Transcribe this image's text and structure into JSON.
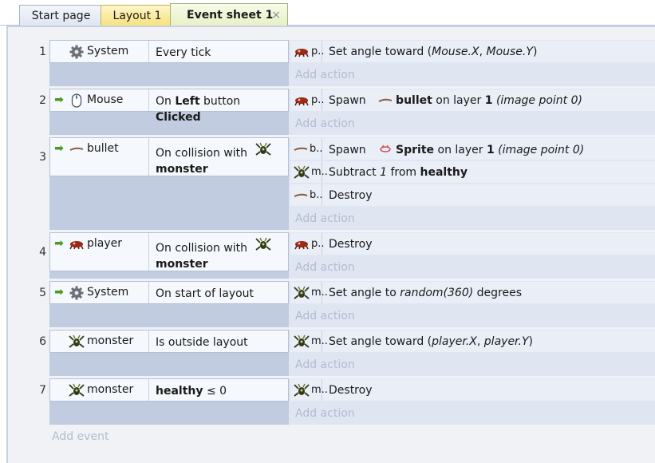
{
  "tabs": [
    {
      "label": "Start page"
    },
    {
      "label": "Layout 1"
    },
    {
      "label": "Event sheet 1",
      "close": "×"
    }
  ],
  "events": [
    {
      "number": "1",
      "trigger": false,
      "object": {
        "icon": "gear-icon",
        "name": "System"
      },
      "condition": {
        "parts": [
          "Every tick"
        ]
      },
      "actions": [
        {
          "icon": "player-sprite-icon",
          "obj": "p..",
          "parts": [
            "Set angle toward (",
            "Mouse.X",
            ", ",
            "Mouse.Y",
            ")"
          ]
        }
      ],
      "add_action": "Add action"
    },
    {
      "number": "2",
      "trigger": true,
      "object": {
        "icon": "mouse-icon",
        "name": "Mouse"
      },
      "condition": {
        "parts": [
          "On ",
          "Left",
          " button ",
          "Clicked"
        ]
      },
      "actions": [
        {
          "icon": "player-sprite-icon",
          "obj": "p..",
          "parts": [
            "Spawn",
            "bullet",
            " on layer ",
            "1",
            " (image point 0)"
          ]
        }
      ],
      "add_action": "Add action"
    },
    {
      "number": "3",
      "trigger": true,
      "object": {
        "icon": "bullet-icon",
        "name": "bullet"
      },
      "condition": {
        "parts": [
          "On collision with",
          "monster"
        ]
      },
      "actions": [
        {
          "icon": "bullet-icon",
          "obj": "b..",
          "parts": [
            "Spawn",
            "Sprite",
            " on layer ",
            "1",
            " (image point 0)"
          ]
        },
        {
          "icon": "monster-icon",
          "obj": "m..",
          "parts": [
            "Subtract ",
            "1",
            " from ",
            "healthy"
          ]
        },
        {
          "icon": "bullet-icon",
          "obj": "b..",
          "parts": [
            "Destroy"
          ]
        }
      ],
      "add_action": "Add action"
    },
    {
      "number": "4",
      "trigger": true,
      "object": {
        "icon": "player-sprite-icon",
        "name": "player"
      },
      "condition": {
        "parts": [
          "On collision with",
          "monster"
        ]
      },
      "actions": [
        {
          "icon": "player-sprite-icon",
          "obj": "p..",
          "parts": [
            "Destroy"
          ]
        }
      ],
      "add_action": "Add action"
    },
    {
      "number": "5",
      "trigger": true,
      "object": {
        "icon": "gear-icon",
        "name": "System"
      },
      "condition": {
        "parts": [
          "On start of layout"
        ]
      },
      "actions": [
        {
          "icon": "monster-icon",
          "obj": "m..",
          "parts": [
            "Set angle to ",
            "random(360)",
            "  degrees"
          ]
        }
      ],
      "add_action": "Add action"
    },
    {
      "number": "6",
      "trigger": false,
      "object": {
        "icon": "monster-icon",
        "name": "monster"
      },
      "condition": {
        "parts": [
          "Is outside layout"
        ]
      },
      "actions": [
        {
          "icon": "monster-icon",
          "obj": "m..",
          "parts": [
            "Set angle toward (",
            "player.X",
            ", ",
            "player.Y",
            ")"
          ]
        }
      ],
      "add_action": "Add action"
    },
    {
      "number": "7",
      "trigger": false,
      "object": {
        "icon": "monster-icon",
        "name": "monster"
      },
      "condition": {
        "parts": [
          "healthy",
          " ≤ 0"
        ]
      },
      "actions": [
        {
          "icon": "monster-icon",
          "obj": "m..",
          "parts": [
            "Destroy"
          ]
        }
      ],
      "add_action": "Add action"
    }
  ],
  "add_event": "Add event",
  "colors": {
    "trigger_arrow": "#4a9b22",
    "condition_bg": "#f5f8fc",
    "condition_col": "#c1cce0",
    "action_bg": "#e9eef7",
    "placeholder": "#b2bcd0"
  }
}
